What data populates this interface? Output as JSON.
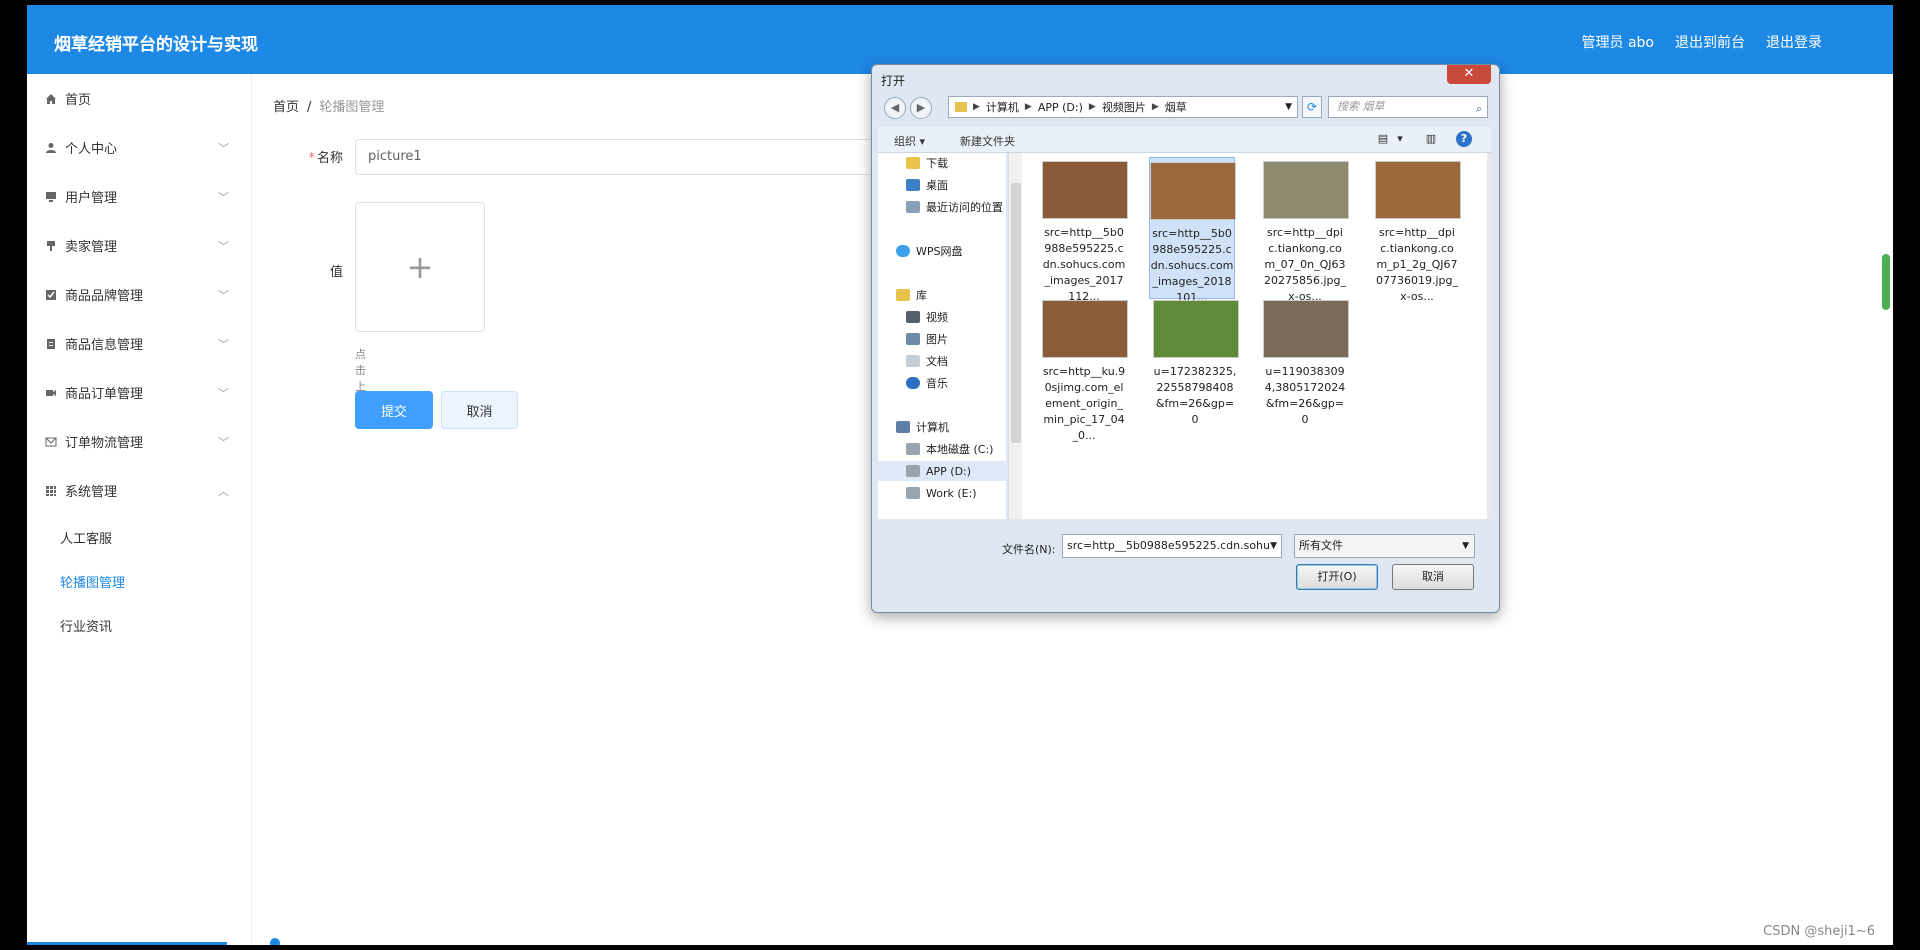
{
  "app": {
    "title": "烟草经销平台的设计与实现",
    "user": "管理员 abo",
    "to_front": "退出到前台",
    "logout": "退出登录"
  },
  "sidebar": {
    "items": [
      {
        "label": "首页",
        "icon": "home-icon"
      },
      {
        "label": "个人中心",
        "icon": "user-icon"
      },
      {
        "label": "用户管理",
        "icon": "monitor-icon"
      },
      {
        "label": "卖家管理",
        "icon": "bookmark-icon"
      },
      {
        "label": "商品品牌管理",
        "icon": "checkbox-icon"
      },
      {
        "label": "商品信息管理",
        "icon": "clipboard-icon"
      },
      {
        "label": "商品订单管理",
        "icon": "video-icon"
      },
      {
        "label": "订单物流管理",
        "icon": "mail-icon"
      },
      {
        "label": "系统管理",
        "icon": "grid-icon"
      }
    ],
    "sub_items": [
      "人工客服",
      "轮播图管理",
      "行业资讯"
    ]
  },
  "breadcrumb": {
    "home": "首页",
    "sep": "/",
    "current": "轮播图管理"
  },
  "form": {
    "name_label": "名称",
    "name_value": "picture1",
    "value_label": "值",
    "upload_plus": "+",
    "upload_hint": "点击上传值",
    "submit": "提交",
    "cancel": "取消"
  },
  "watermark": "CSDN @sheji1~6",
  "dialog": {
    "title": "打开",
    "close": "✕",
    "address": [
      "计算机",
      "APP (D:)",
      "视频图片",
      "烟草"
    ],
    "search_placeholder": "搜索 烟草",
    "organize": "组织 ▾",
    "new_folder": "新建文件夹",
    "tree": [
      {
        "label": "下载",
        "color": "#e8c34a"
      },
      {
        "label": "桌面",
        "color": "#3d7fc9"
      },
      {
        "label": "最近访问的位置",
        "color": "#8aa0b8"
      },
      {
        "label": "WPS网盘",
        "color": "#3aa0e8"
      },
      {
        "label": "库",
        "color": "#e8c34a"
      },
      {
        "label": "视频",
        "color": "#56606c"
      },
      {
        "label": "图片",
        "color": "#6f8aa8"
      },
      {
        "label": "文档",
        "color": "#c8ced6"
      },
      {
        "label": "音乐",
        "color": "#2d6fc0"
      },
      {
        "label": "计算机",
        "color": "#5d7ea8"
      },
      {
        "label": "本地磁盘 (C:)",
        "color": "#9aa4ae"
      },
      {
        "label": "APP (D:)",
        "color": "#9aa4ae"
      },
      {
        "label": "Work (E:)",
        "color": "#9aa4ae"
      }
    ],
    "files": [
      {
        "name": "src=http__5b0988e595225.cdn.sohucs.com_images_2017112...",
        "color": "#8a5a3a"
      },
      {
        "name": "src=http__5b0988e595225.cdn.sohucs.com_images_2018101...",
        "color": "#9a6a3e"
      },
      {
        "name": "src=http__dpic.tiankong.com_07_0n_QJ6320275856.jpg_x-os...",
        "color": "#8d8a70"
      },
      {
        "name": "src=http__dpic.tiankong.com_p1_2g_QJ6707736019.jpg_x-os...",
        "color": "#9c6a3a"
      },
      {
        "name": "src=http__ku.90sjimg.com_element_origin_min_pic_17_04_0...",
        "color": "#8a5e3a"
      },
      {
        "name": "u=172382325,22558798408&fm=26&gp=0",
        "color": "#5f8a3a"
      },
      {
        "name": "u=1190383094,3805172024&fm=26&gp=0",
        "color": "#7a6a5a"
      }
    ],
    "filename_label": "文件名(N):",
    "filename_value": "src=http__5b0988e595225.cdn.sohu",
    "filetype": "所有文件",
    "open": "打开(O)",
    "cancel": "取消"
  }
}
